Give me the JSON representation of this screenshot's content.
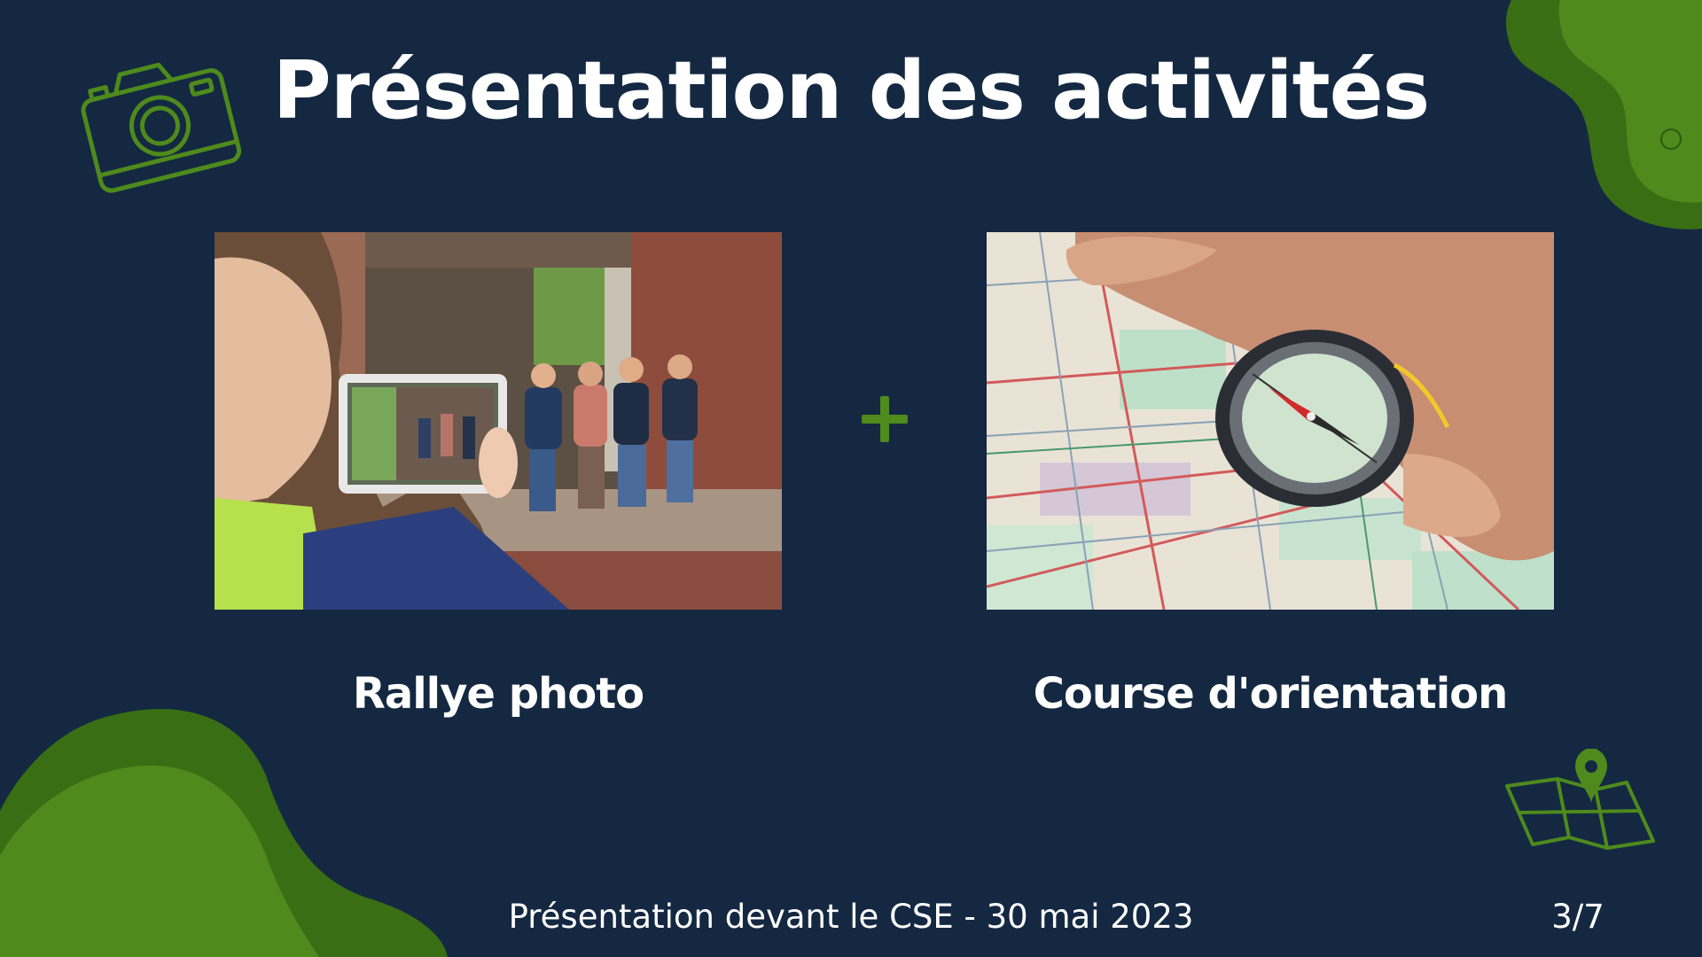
{
  "slide": {
    "title": "Présentation des activités",
    "activities": [
      {
        "caption": "Rallye photo",
        "image": "group-photo-tablet"
      },
      {
        "caption": "Course d'orientation",
        "image": "compass-on-map"
      }
    ],
    "connector_icon": "plus-icon",
    "footer": "Présentation devant le CSE - 30 mai 2023",
    "page_number": "3/7",
    "icons": [
      "camera-icon",
      "map-pin-icon"
    ]
  },
  "colors": {
    "background": "#142842",
    "accent_green": "#4e8a1c",
    "dark_green": "#3a6e14",
    "text": "#ffffff"
  }
}
